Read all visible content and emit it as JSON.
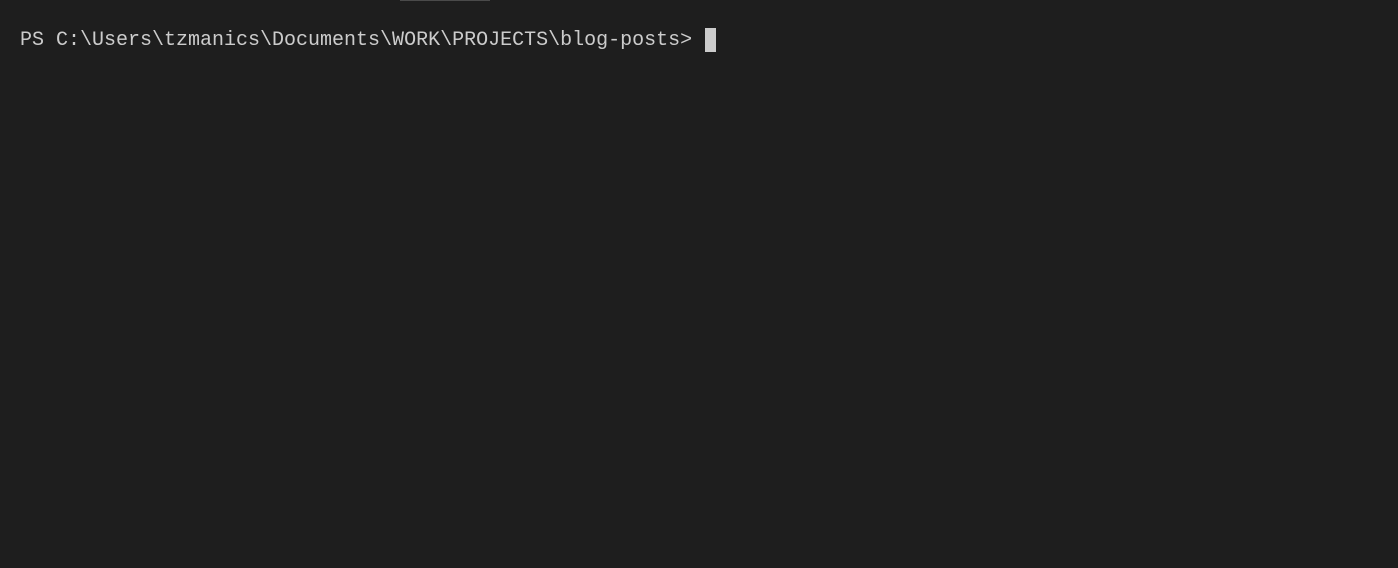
{
  "terminal": {
    "prompt": "PS C:\\Users\\tzmanics\\Documents\\WORK\\PROJECTS\\blog-posts> ",
    "input": ""
  }
}
